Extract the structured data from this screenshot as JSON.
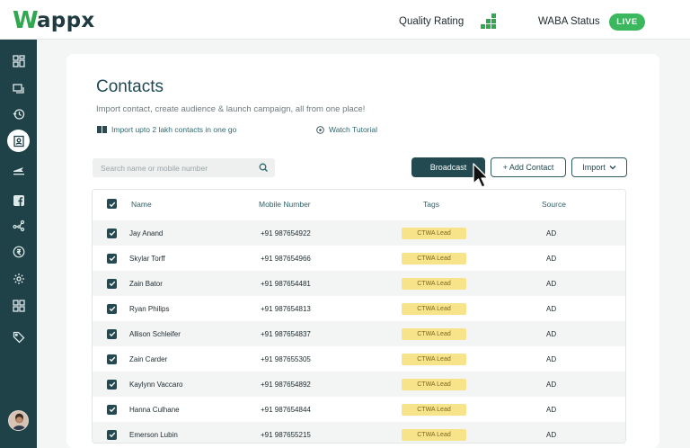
{
  "header": {
    "logo": "appx",
    "logo_letter": "W",
    "quality_rating_label": "Quality Rating",
    "waba_status_label": "WABA Status",
    "live_badge": "LIVE"
  },
  "sidebar": {
    "items": [
      {
        "icon": "dashboard-icon"
      },
      {
        "icon": "chat-icon"
      },
      {
        "icon": "history-icon"
      },
      {
        "icon": "contacts-icon",
        "active": true
      },
      {
        "icon": "campaign-icon"
      },
      {
        "icon": "facebook-icon"
      },
      {
        "icon": "flow-icon"
      },
      {
        "icon": "currency-icon"
      },
      {
        "icon": "gear-icon"
      },
      {
        "icon": "apps-icon"
      },
      {
        "icon": "tag-icon"
      }
    ]
  },
  "page": {
    "title": "Contacts",
    "subtitle": "Import contact, create audience & launch campaign, all from one place!",
    "import_note": "Import upto 2 lakh contacts in one go",
    "watch_tutorial": "Watch Tutorial"
  },
  "search": {
    "placeholder": "Search name or mobile number"
  },
  "actions": {
    "broadcast": "Broadcast",
    "add_contact": "+ Add Contact",
    "import": "Import"
  },
  "table": {
    "columns": [
      "Name",
      "Mobile Number",
      "Tags",
      "Source"
    ],
    "rows": [
      {
        "name": "Jay Anand",
        "mobile": "+91 987654922",
        "tag": "CTWA Lead",
        "source": "AD"
      },
      {
        "name": "Skylar Torff",
        "mobile": "+91 987654966",
        "tag": "CTWA Lead",
        "source": "AD"
      },
      {
        "name": "Zain Bator",
        "mobile": "+91 987654481",
        "tag": "CTWA Lead",
        "source": "AD"
      },
      {
        "name": "Ryan Philips",
        "mobile": "+91 987654813",
        "tag": "CTWA Lead",
        "source": "AD"
      },
      {
        "name": "Allison Schleifer",
        "mobile": "+91 987654837",
        "tag": "CTWA Lead",
        "source": "AD"
      },
      {
        "name": "Zain Carder",
        "mobile": "+91 987655305",
        "tag": "CTWA Lead",
        "source": "AD"
      },
      {
        "name": "Kaylynn Vaccaro",
        "mobile": "+91 987654892",
        "tag": "CTWA Lead",
        "source": "AD"
      },
      {
        "name": "Hanna Culhane",
        "mobile": "+91 987654844",
        "tag": "CTWA Lead",
        "source": "AD"
      },
      {
        "name": "Emerson Lubin",
        "mobile": "+91 987655215",
        "tag": "CTWA Lead",
        "source": "AD"
      }
    ]
  },
  "colors": {
    "brand_dark": "#1f4248",
    "brand_green": "#3bb75e",
    "tag_bg": "#f7e48a"
  }
}
